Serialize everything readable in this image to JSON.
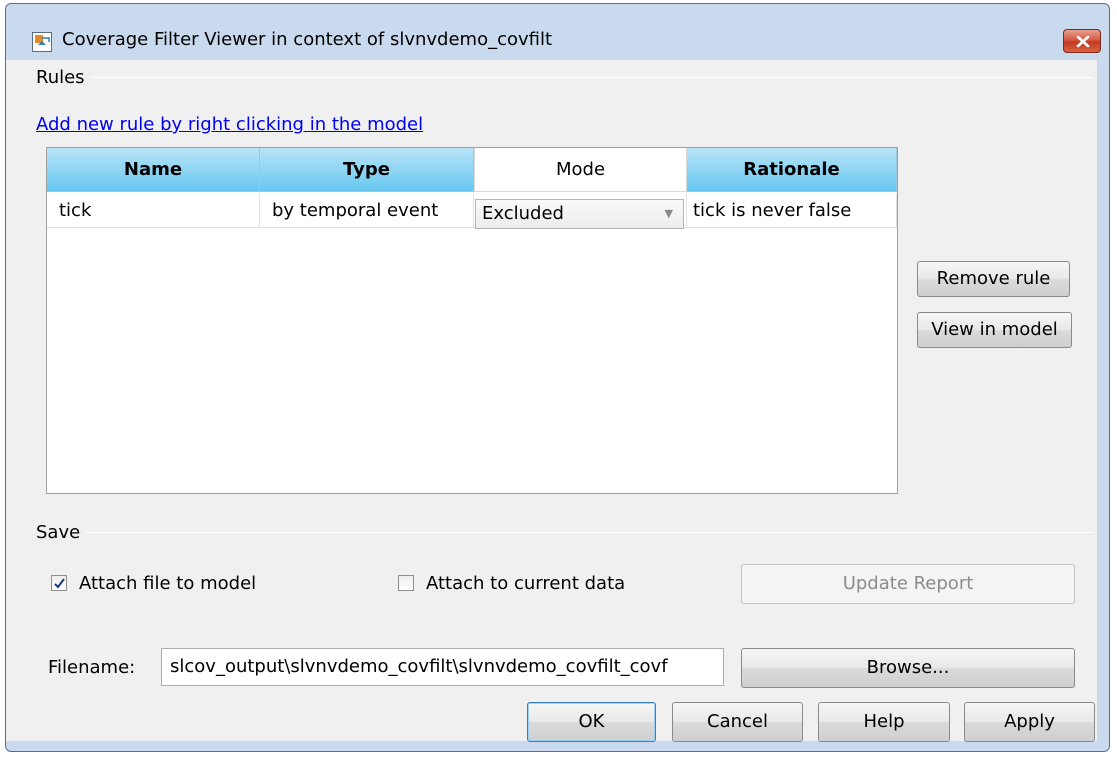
{
  "window": {
    "title": "Coverage Filter Viewer in context of slvnvdemo_covfilt"
  },
  "rules": {
    "group_label": "Rules",
    "add_link": "Add new rule by right clicking in the model",
    "columns": {
      "name": "Name",
      "type": "Type",
      "mode": "Mode",
      "rationale": "Rationale"
    },
    "rows": [
      {
        "name": "tick",
        "type": "by temporal event",
        "mode": "Excluded",
        "rationale": "tick is never false"
      }
    ],
    "remove_label": "Remove rule",
    "view_label": "View in model"
  },
  "save": {
    "group_label": "Save",
    "attach_file_label": "Attach file to model",
    "attach_file_checked": true,
    "attach_data_label": "Attach to current data",
    "attach_data_checked": false,
    "update_label": "Update Report",
    "filename_label": "Filename:",
    "filename_value": "slcov_output\\slvnvdemo_covfilt\\slvnvdemo_covfilt_covf",
    "browse_label": "Browse..."
  },
  "footer": {
    "ok_label": "OK",
    "cancel_label": "Cancel",
    "help_label": "Help",
    "apply_label": "Apply"
  },
  "colors": {
    "header_accent": "#66c7f0",
    "close_red": "#c8472d",
    "link": "#0000ee"
  }
}
